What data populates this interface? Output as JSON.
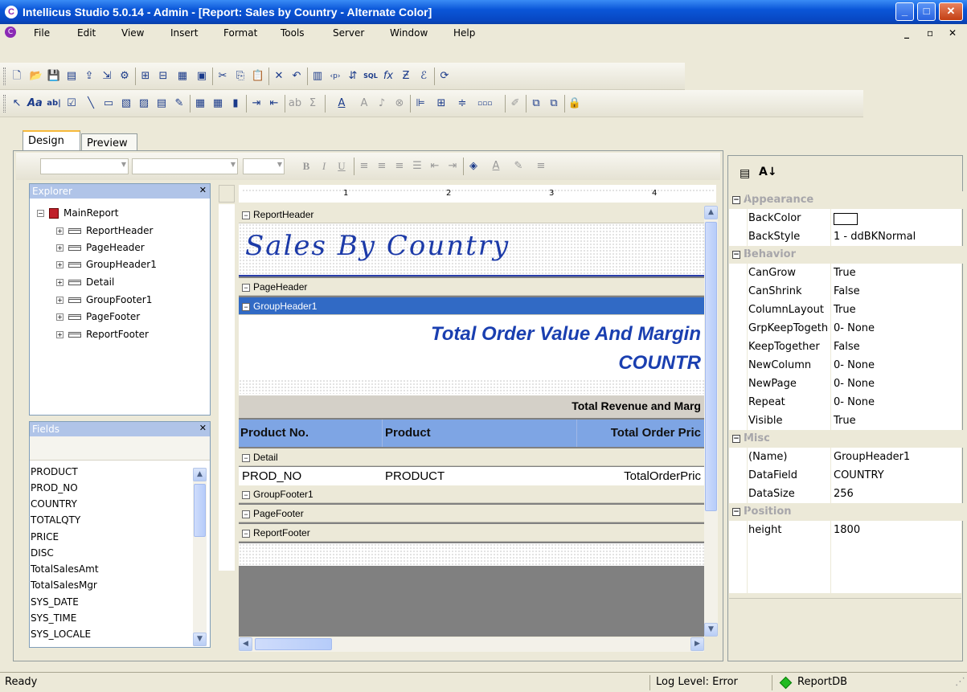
{
  "window": {
    "title": "Intellicus Studio 5.0.14 - Admin - [Report: Sales by Country - Alternate Color]"
  },
  "menu": [
    "File",
    "Edit",
    "View",
    "Insert",
    "Format",
    "Tools",
    "Server",
    "Window",
    "Help"
  ],
  "tabs": {
    "design": "Design",
    "preview": "Preview"
  },
  "explorer": {
    "title": "Explorer",
    "root": "MainReport",
    "items": [
      "ReportHeader",
      "PageHeader",
      "GroupHeader1",
      "Detail",
      "GroupFooter1",
      "PageFooter",
      "ReportFooter"
    ]
  },
  "fields": {
    "title": "Fields",
    "items": [
      "PRODUCT",
      "PROD_NO",
      "COUNTRY",
      "TOTALQTY",
      "PRICE",
      "DISC",
      "TotalSalesAmt",
      "TotalSalesMgr",
      "SYS_DATE",
      "SYS_TIME",
      "SYS_LOCALE"
    ]
  },
  "format": {
    "bold": "B",
    "italic": "I",
    "underline": "U"
  },
  "ruler": {
    "marks": [
      "1",
      "2",
      "3",
      "4"
    ]
  },
  "canvas": {
    "sections": {
      "report_header": "ReportHeader",
      "page_header": "PageHeader",
      "group_header": "GroupHeader1",
      "detail": "Detail",
      "group_footer": "GroupFooter1",
      "page_footer": "PageFooter",
      "report_footer": "ReportFooter"
    },
    "title": "Sales By Country",
    "group_title_1": "Total Order Value And Margin",
    "group_title_2": "COUNTR",
    "subheader": "Total Revenue and Marg",
    "col_headers": [
      "Product No.",
      "Product",
      "Total Order Pric"
    ],
    "detail_fields": [
      "PROD_NO",
      "PRODUCT",
      "TotalOrderPric"
    ]
  },
  "properties": {
    "categories": {
      "appearance": "Appearance",
      "behavior": "Behavior",
      "misc": "Misc",
      "position": "Position"
    },
    "appearance": [
      {
        "name": "BackColor",
        "value": ""
      },
      {
        "name": "BackStyle",
        "value": "1 - ddBKNormal"
      }
    ],
    "behavior": [
      {
        "name": "CanGrow",
        "value": "True"
      },
      {
        "name": "CanShrink",
        "value": "False"
      },
      {
        "name": "ColumnLayout",
        "value": "True"
      },
      {
        "name": "GrpKeepTogether",
        "value": "0- None"
      },
      {
        "name": "KeepTogether",
        "value": "False"
      },
      {
        "name": "NewColumn",
        "value": "0- None"
      },
      {
        "name": "NewPage",
        "value": "0- None"
      },
      {
        "name": "Repeat",
        "value": "0- None"
      },
      {
        "name": "Visible",
        "value": "True"
      }
    ],
    "misc": [
      {
        "name": "(Name)",
        "value": "GroupHeader1"
      },
      {
        "name": "DataField",
        "value": "COUNTRY"
      },
      {
        "name": "DataSize",
        "value": "256"
      }
    ],
    "position": [
      {
        "name": "height",
        "value": "1800"
      }
    ]
  },
  "statusbar": {
    "left": "Ready",
    "log": "Log Level: Error",
    "db": "ReportDB"
  },
  "colors": {
    "title_blue": "#0a56d8",
    "selected_band": "#316ac5",
    "db_status": "#22bb22"
  }
}
